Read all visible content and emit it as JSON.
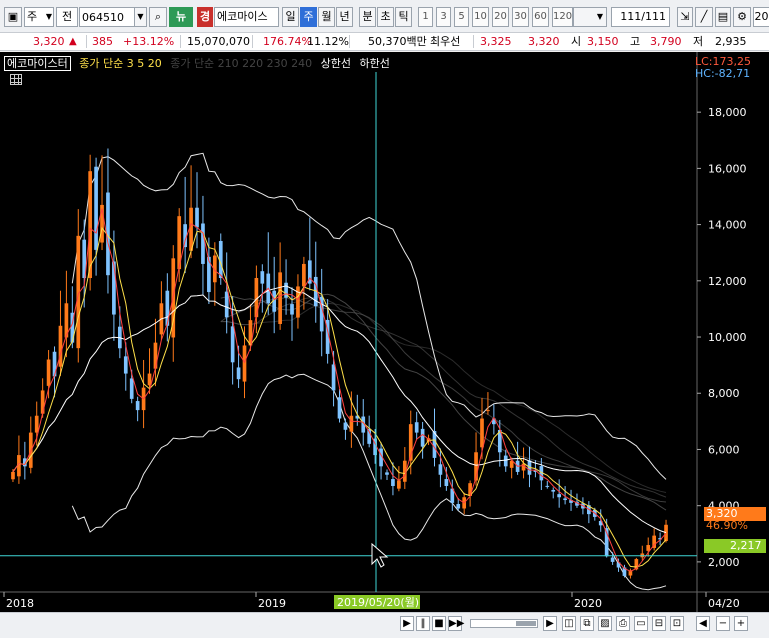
{
  "toolbar": {
    "period": "주",
    "market": "전",
    "code": "064510",
    "news_button": "뉴",
    "warning_badge": "경",
    "stock_name": "에코마이스",
    "timeframes": [
      "일",
      "주",
      "월",
      "년",
      "분",
      "초",
      "틱"
    ],
    "active_timeframe": "주",
    "intervals": [
      "1",
      "3",
      "5",
      "10",
      "20",
      "30",
      "60",
      "120"
    ],
    "page_counter": "111",
    "page_total": "/111",
    "right_number": "20"
  },
  "quote": {
    "price": "3,320",
    "arrow": "▲",
    "change": "385",
    "change_pct": "+13.12%",
    "volume": "15,070,070",
    "volume_ratio": "176.74%",
    "turnover_pct": "11.12%",
    "trading_value": "50,370백만",
    "best_label": "최우선",
    "best_ask": "3,325",
    "best_bid": "3,320",
    "open_label": "시",
    "open": "3,150",
    "high_label": "고",
    "high": "3,790",
    "low_label": "저",
    "low": "2,935"
  },
  "legend": {
    "name": "에코마이스터",
    "ma_short": "종가 단순 3 5 20",
    "ma_long": "종가 단순 210 220 230 240",
    "upper_limit": "상한선",
    "lower_limit": "하한선"
  },
  "right_info": {
    "lc": "LC:173,25",
    "hc": "HC:-82,71"
  },
  "tags": {
    "last_price": "3,320",
    "last_pct": "46.90%",
    "crosshair_price": "2,217"
  },
  "crosshair_date": "2019/05/20(월)",
  "colors": {
    "background": "#000000",
    "up_candle": "#ff7a1a",
    "down_candle": "#7fc3ff",
    "ma3": "#ff4040",
    "ma5": "#ffe04a",
    "ma20": "#ffffff",
    "crosshair": "#3fd6d6",
    "axis_text": "#ffffff"
  },
  "chart_data": {
    "type": "candlestick",
    "x_ticks": [
      "2018",
      "2019",
      "2020",
      "04/20"
    ],
    "y_ticks": [
      2000,
      4000,
      6000,
      8000,
      10000,
      12000,
      14000,
      16000,
      18000
    ],
    "ylim": [
      1000,
      19500
    ],
    "closes": [
      5200,
      5800,
      5400,
      6600,
      7200,
      8100,
      9200,
      8600,
      10400,
      11200,
      9800,
      13600,
      12100,
      15900,
      13100,
      14700,
      12200,
      10800,
      9600,
      8700,
      7800,
      7400,
      8200,
      8700,
      9800,
      11200,
      10400,
      12800,
      14300,
      13200,
      14600,
      13900,
      12600,
      11600,
      12900,
      12100,
      10700,
      9100,
      8500,
      9700,
      10600,
      12100,
      11900,
      11200,
      10900,
      12300,
      11400,
      10800,
      11800,
      12600,
      11900,
      11100,
      10200,
      9400,
      8100,
      7100,
      6700,
      7200,
      7100,
      6600,
      6200,
      5800,
      5400,
      5100,
      4700,
      4900,
      5600,
      6900,
      6600,
      6100,
      6400,
      5700,
      5100,
      4700,
      4100,
      3900,
      4300,
      4800,
      5900,
      7100,
      7400,
      6900,
      5900,
      5400,
      5600,
      5200,
      5500,
      5100,
      5200,
      4900,
      4700,
      4500,
      4300,
      4200,
      4100,
      4000,
      3900,
      3700,
      3600,
      3300,
      2200,
      2000,
      1800,
      1500,
      1700,
      2100,
      2300,
      2600,
      2935,
      2800,
      3320
    ],
    "upper_band_end": 5900,
    "lower_band_end": 1600,
    "crosshair_value": 2217
  }
}
